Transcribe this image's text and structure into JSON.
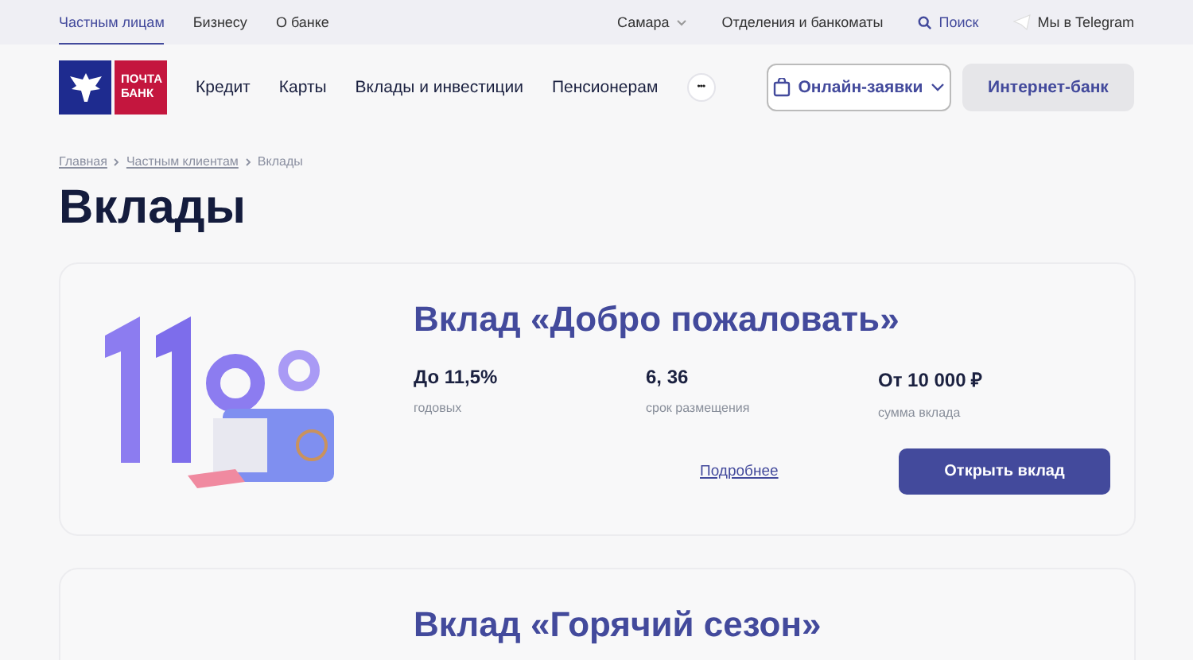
{
  "top_bar": {
    "segments": [
      {
        "label": "Частным лицам",
        "selected": true
      },
      {
        "label": "Бизнесу",
        "selected": false
      },
      {
        "label": "О банке",
        "selected": false
      }
    ],
    "city": "Самара",
    "branches": "Отделения и банкоматы",
    "search": "Поиск",
    "telegram": "Мы в Telegram"
  },
  "header": {
    "logo": [
      "ПОЧТА",
      "БАНК"
    ],
    "nav": [
      "Кредит",
      "Карты",
      "Вклады и инвестиции",
      "Пенсионерам"
    ],
    "more": "•••",
    "applications": "Онлайн-заявки",
    "internet_bank": "Интернет-банк"
  },
  "breadcrumbs": [
    {
      "label": "Главная",
      "link": true
    },
    {
      "label": "Частным клиентам",
      "link": true
    },
    {
      "label": "Вклады",
      "link": false
    }
  ],
  "title": "Вклады",
  "deposits": [
    {
      "name": "Вклад «Добро пожаловать»",
      "facts": [
        {
          "value": "До 11,5%",
          "caption": "годовых"
        },
        {
          "value": "6, 36",
          "caption": "срок размещения"
        },
        {
          "value": "От 10 000 ₽",
          "caption": "сумма вклада"
        }
      ],
      "more": "Подробнее",
      "open": "Открыть вклад"
    },
    {
      "name": "Вклад «Горячий сезон»"
    }
  ]
}
